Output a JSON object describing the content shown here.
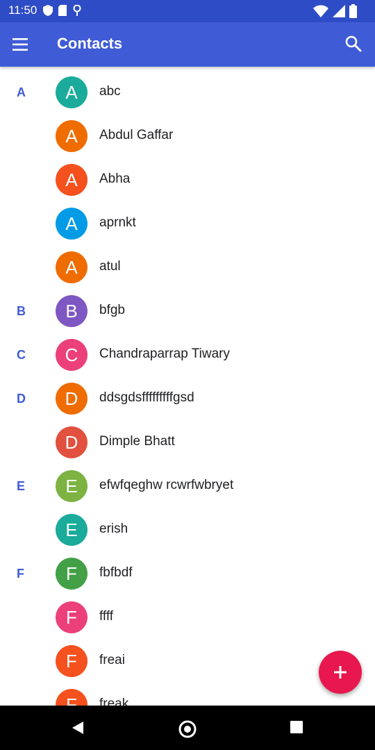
{
  "status_bar": {
    "time": "11:50"
  },
  "app_bar": {
    "title": "Contacts"
  },
  "colors": {
    "status_bar": "#2f4cc7",
    "app_bar": "#3f5bd6",
    "fab": "#e8184e",
    "section_letter": "#3f5bd6"
  },
  "contacts": [
    {
      "section": "A",
      "initial": "A",
      "name": "abc",
      "color": "#1aab9b"
    },
    {
      "section": "",
      "initial": "A",
      "name": "Abdul Gaffar",
      "color": "#ef6c00"
    },
    {
      "section": "",
      "initial": "A",
      "name": "Abha",
      "color": "#f4511e"
    },
    {
      "section": "",
      "initial": "A",
      "name": "aprnkt",
      "color": "#039be5"
    },
    {
      "section": "",
      "initial": "A",
      "name": "atul",
      "color": "#ef6c00"
    },
    {
      "section": "B",
      "initial": "B",
      "name": "bfgb",
      "color": "#7e57c2"
    },
    {
      "section": "C",
      "initial": "C",
      "name": "Chandraparrap Tiwary",
      "color": "#ec407a"
    },
    {
      "section": "D",
      "initial": "D",
      "name": "ddsgdsfffffffffgsd",
      "color": "#ef6c00"
    },
    {
      "section": "",
      "initial": "D",
      "name": "Dimple Bhatt",
      "color": "#e2503f"
    },
    {
      "section": "E",
      "initial": "E",
      "name": "efwfqeghw rcwrfwbryet",
      "color": "#7cb342"
    },
    {
      "section": "",
      "initial": "E",
      "name": "erish",
      "color": "#1aab9b"
    },
    {
      "section": "F",
      "initial": "F",
      "name": "fbfbdf",
      "color": "#43a047"
    },
    {
      "section": "",
      "initial": "F",
      "name": "ffff",
      "color": "#ec407a"
    },
    {
      "section": "",
      "initial": "F",
      "name": "freai",
      "color": "#f4511e"
    },
    {
      "section": "",
      "initial": "F",
      "name": "freak",
      "color": "#f4511e"
    }
  ],
  "icons": {
    "menu": "menu-icon",
    "search": "search-icon",
    "add": "add-icon",
    "back": "back-icon",
    "home": "home-icon",
    "recents": "recents-icon"
  }
}
